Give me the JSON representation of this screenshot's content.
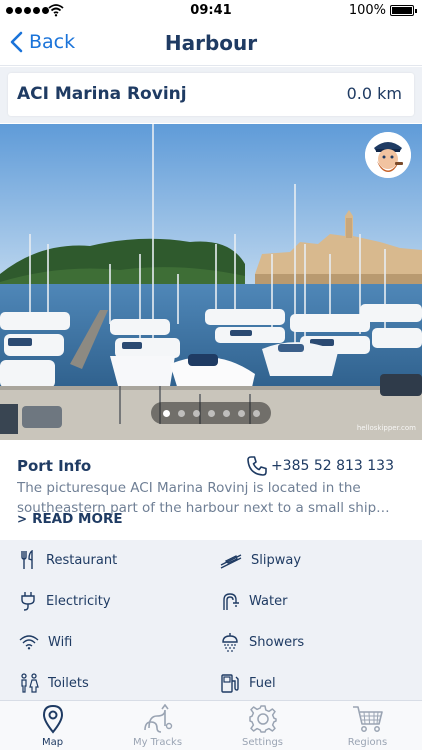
{
  "status_bar": {
    "time": "09:41",
    "battery": "100%"
  },
  "navbar": {
    "back_label": "Back",
    "title": "Harbour"
  },
  "marina": {
    "name": "ACI Marina Rovinj",
    "distance": "0.0 km"
  },
  "photo": {
    "watermark": "helloskipper.com",
    "dot_count": 7,
    "active_dot": 0
  },
  "port_info": {
    "title": "Port Info",
    "phone": "+385 52 813 133",
    "description": "The picturesque ACI Marina Rovinj is located in the southeastern part of the harbour next to a small ship…",
    "read_more": "READ MORE"
  },
  "amenities": [
    {
      "label": "Restaurant",
      "icon": "fork-knife-icon"
    },
    {
      "label": "Slipway",
      "icon": "slipway-icon"
    },
    {
      "label": "Electricity",
      "icon": "plug-icon"
    },
    {
      "label": "Water",
      "icon": "water-tap-icon"
    },
    {
      "label": "Wifi",
      "icon": "wifi-icon"
    },
    {
      "label": "Showers",
      "icon": "shower-icon"
    },
    {
      "label": "Toilets",
      "icon": "toilets-icon"
    },
    {
      "label": "Fuel",
      "icon": "fuel-icon"
    }
  ],
  "tabs": [
    {
      "label": "Map",
      "icon": "map-pin-icon",
      "active": true
    },
    {
      "label": "My Tracks",
      "icon": "tracks-icon",
      "active": false
    },
    {
      "label": "Settings",
      "icon": "gear-icon",
      "active": false
    },
    {
      "label": "Regions",
      "icon": "cart-icon",
      "active": false
    }
  ],
  "colors": {
    "navy": "#1f3b63",
    "accent": "#1a73d9",
    "panel": "#eef1f6"
  }
}
